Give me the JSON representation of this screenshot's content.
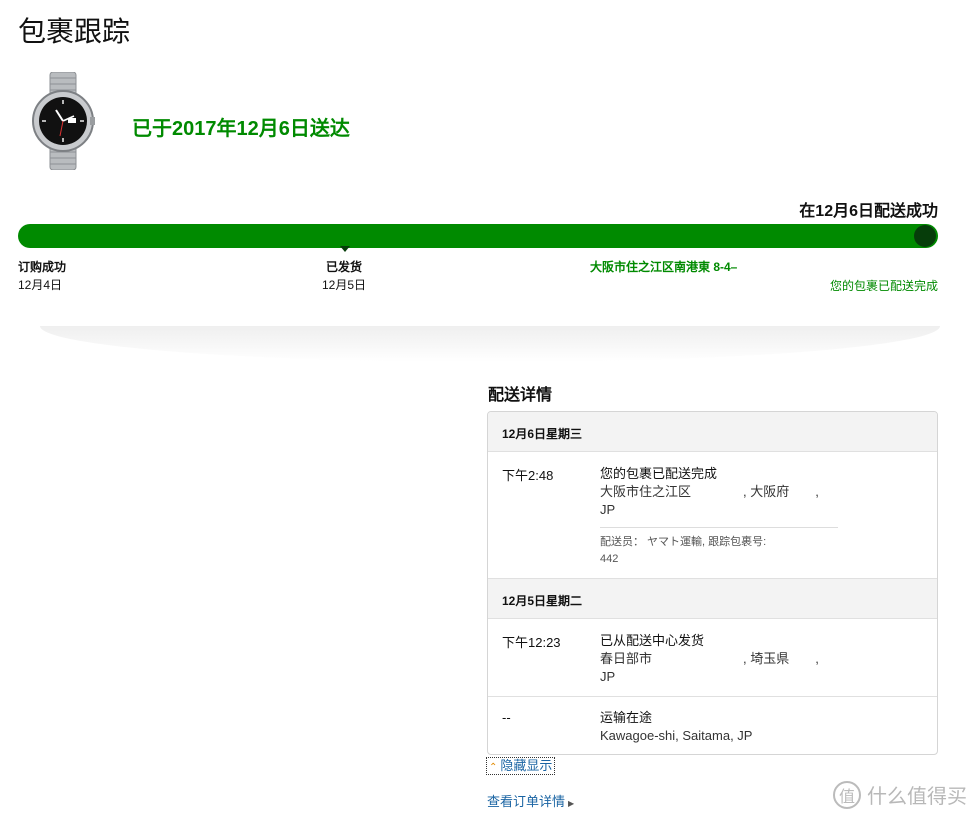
{
  "page": {
    "title": "包裹跟踪"
  },
  "product": {
    "image_alt": "watch"
  },
  "delivery": {
    "headline": "已于2017年12月6日送达",
    "status_right": "在12月6日配送成功"
  },
  "progress": {
    "fill": 1.0,
    "ordered": {
      "label": "订购成功",
      "date": "12月4日"
    },
    "shipped": {
      "label": "已发货",
      "date": "12月5日"
    },
    "destination": "大阪市住之江区南港東 8-4–",
    "completed_note": "您的包裹已配送完成"
  },
  "details": {
    "title": "配送详情",
    "days": [
      {
        "date": "12月6日星期三",
        "events": [
          {
            "time": "下午2:48",
            "status": "您的包裹已配送完成",
            "location_line1": "大阪市住之江区　　　　, 大阪府　　,",
            "location_line2": "JP",
            "carrier_line1": "配送员： ヤマト運輸, 跟踪包裹号:",
            "carrier_line2": "442"
          }
        ]
      },
      {
        "date": "12月5日星期二",
        "events": [
          {
            "time": "下午12:23",
            "status": "已从配送中心发货",
            "location_line1": "春日部市　　　　　　　, 埼玉県　　,",
            "location_line2": "JP"
          },
          {
            "time": "--",
            "status": "运输在途",
            "location_line1": "Kawagoe-shi, Saitama, JP"
          }
        ]
      }
    ]
  },
  "links": {
    "hide": "隐藏显示",
    "order_details": "查看订单详情"
  },
  "watermark": {
    "text": "什么值得买",
    "badge": "值"
  },
  "colors": {
    "green": "#008a00",
    "dark_green": "#063d0a",
    "link": "#1a64a3"
  }
}
